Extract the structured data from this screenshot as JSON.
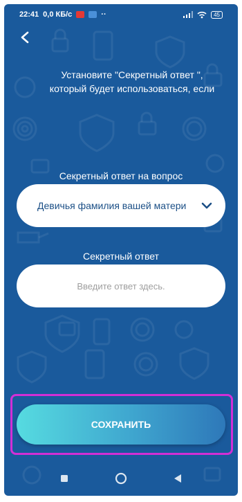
{
  "status_bar": {
    "time": "22:41",
    "speed": "0,0 КБ/с",
    "dots": "··",
    "battery": "45"
  },
  "header": {
    "instruction": "Установите \"Секретный ответ \", который будет использоваться, если"
  },
  "form": {
    "question_label": "Секретный ответ на вопрос",
    "question_selected": "Девичья фамилия вашей матери",
    "answer_label": "Секретный ответ",
    "answer_placeholder": "Введите ответ здесь.",
    "answer_value": ""
  },
  "actions": {
    "save_label": "СОХРАНИТЬ"
  },
  "colors": {
    "background": "#1a5a9c",
    "select_text": "#1b4f86",
    "highlight": "#d22fd6",
    "button_gradient_start": "#56dbe0",
    "button_gradient_end": "#2e78b9"
  },
  "icons": {
    "back": "arrow-left-icon",
    "chevron": "chevron-down-icon",
    "nav_recent": "square-icon",
    "nav_home": "circle-icon",
    "nav_back": "triangle-back-icon"
  }
}
